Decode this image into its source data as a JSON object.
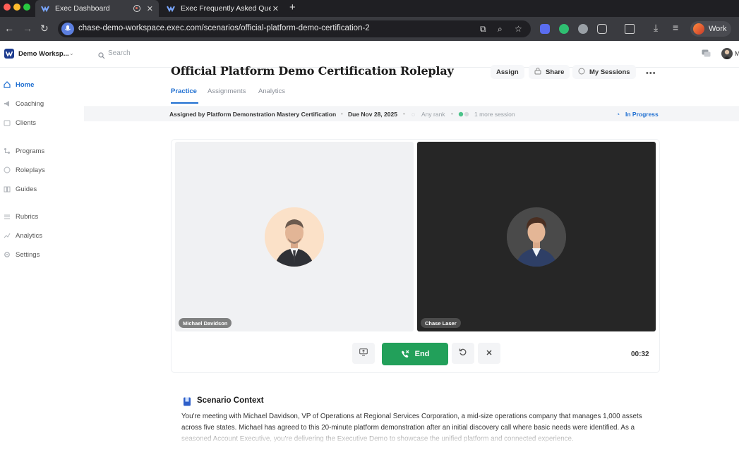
{
  "browser": {
    "tabs": [
      {
        "title": "Exec Dashboard",
        "active": true
      },
      {
        "title": "Exec Frequently Asked Quest",
        "active": false
      }
    ],
    "url": "chase-demo-workspace.exec.com/scenarios/official-platform-demo-certification-2",
    "profile_label": "Work"
  },
  "app": {
    "workspace_name": "Demo Worksp...",
    "search_placeholder": "Search",
    "user_initial": "M"
  },
  "sidebar": {
    "items": [
      {
        "label": "Home",
        "icon": "home-icon",
        "active": true
      },
      {
        "label": "Coaching",
        "icon": "megaphone-icon"
      },
      {
        "label": "Clients",
        "icon": "clients-icon"
      },
      {
        "label": "Programs",
        "icon": "programs-icon"
      },
      {
        "label": "Roleplays",
        "icon": "roleplays-icon"
      },
      {
        "label": "Guides",
        "icon": "book-icon"
      },
      {
        "label": "Rubrics",
        "icon": "rubrics-icon"
      },
      {
        "label": "Analytics",
        "icon": "analytics-icon"
      },
      {
        "label": "Settings",
        "icon": "gear-icon"
      }
    ]
  },
  "page": {
    "title": "Official Platform Demo Certification Roleplay",
    "actions": {
      "assign": "Assign",
      "share": "Share",
      "sessions": "My Sessions"
    },
    "tabs": [
      "Practice",
      "Assignments",
      "Analytics"
    ],
    "meta": {
      "assigned_by": "Assigned by Platform Demonstration Mastery Certification",
      "due": "Due Nov 28, 2025",
      "rank": "Any rank",
      "sessions": "1 more session",
      "status": "In Progress"
    }
  },
  "roleplay": {
    "participants": [
      {
        "name": "Michael Davidson"
      },
      {
        "name": "Chase Laser"
      }
    ],
    "end_label": "End",
    "timer": "00:32"
  },
  "context": {
    "title": "Scenario Context",
    "body": "You're meeting with Michael Davidson, VP of Operations at Regional Services Corporation, a mid-size operations company that manages 1,000 assets across five states. Michael has agreed to this 20-minute platform demonstration after an initial discovery call where basic needs were identified. As a seasoned Account Executive, you're delivering the Executive Demo to showcase the unified platform and connected experience."
  },
  "colors": {
    "accent": "#1f6fd1",
    "end_button": "#22a05a",
    "brand": "#1d3c8f"
  }
}
